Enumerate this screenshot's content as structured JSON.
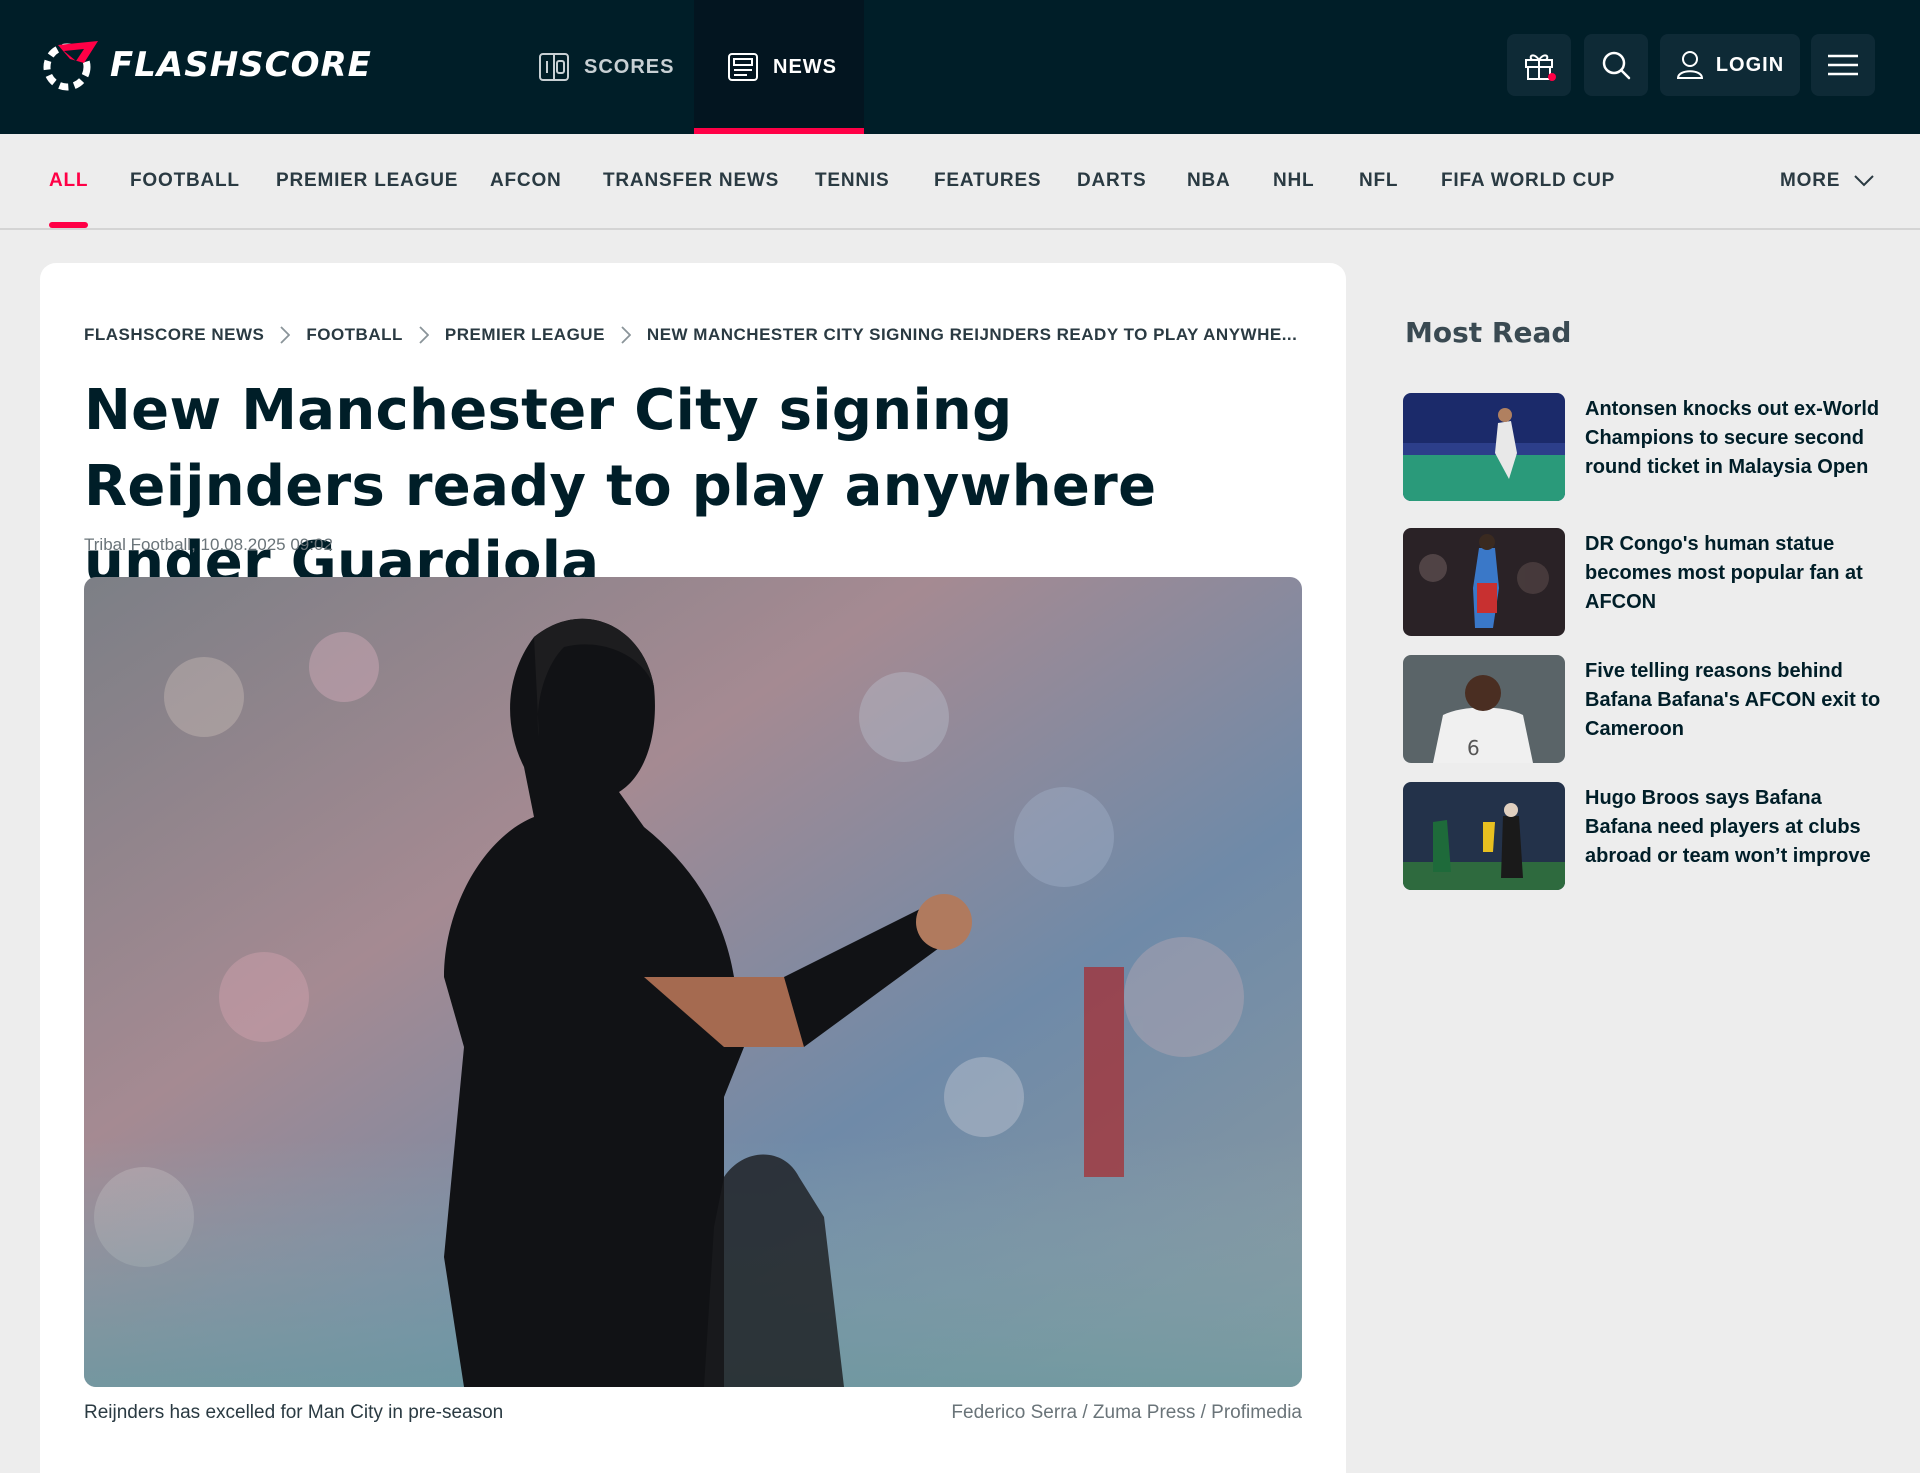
{
  "header": {
    "brand": "FLASHSCORE",
    "tabs": [
      {
        "label": "SCORES",
        "icon": "scoreboard-icon",
        "active": false
      },
      {
        "label": "NEWS",
        "icon": "newspaper-icon",
        "active": true
      }
    ],
    "gift_icon": "gift-icon",
    "search_icon": "search-icon",
    "login_label": "LOGIN",
    "menu_icon": "hamburger-menu-icon"
  },
  "sport_nav": {
    "items": [
      "ALL",
      "FOOTBALL",
      "PREMIER LEAGUE",
      "AFCON",
      "TRANSFER NEWS",
      "TENNIS",
      "FEATURES",
      "DARTS",
      "NBA",
      "NHL",
      "NFL",
      "FIFA WORLD CUP"
    ],
    "active": "ALL",
    "more_label": "MORE"
  },
  "article": {
    "breadcrumb": [
      "FLASHSCORE NEWS",
      "FOOTBALL",
      "PREMIER LEAGUE",
      "NEW MANCHESTER CITY SIGNING REIJNDERS READY TO PLAY ANYWHE..."
    ],
    "title": "New Manchester City signing Reijnders ready to play anywhere under Guardiola",
    "source": "Tribal Football,",
    "datetime": "10.08.2025 09:02",
    "image_caption": "Reijnders has excelled for Man City in pre-season",
    "image_credit": "Federico Serra / Zuma Press / Profimedia"
  },
  "most_read": {
    "title": "Most Read",
    "items": [
      {
        "text": "Antonsen knocks out ex-World Champions to secure second round ticket in Malaysia Open"
      },
      {
        "text": "DR Congo's human statue becomes most popular fan at AFCON"
      },
      {
        "text": "Five telling reasons behind Bafana Bafana's AFCON exit to Cameroon"
      },
      {
        "text": "Hugo Broos says Bafana Bafana need players at clubs abroad or team won’t improve"
      }
    ]
  },
  "colors": {
    "header_bg": "#001e28",
    "accent": "#ff0046",
    "page_bg": "#ededed"
  }
}
